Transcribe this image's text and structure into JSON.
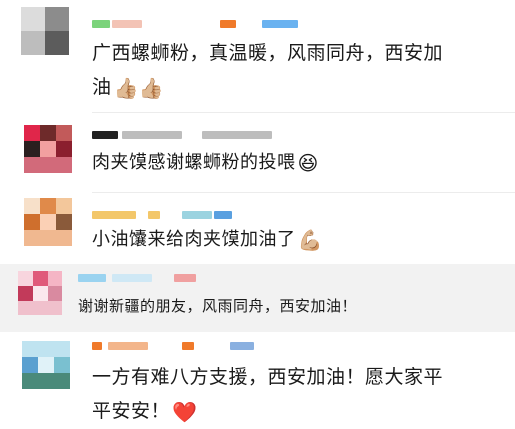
{
  "comments": [
    {
      "lines": [
        "广西螺蛳粉，真温暖，风雨同舟，西安加",
        "油"
      ],
      "emoji": "👍🏼👍🏼",
      "colors": {
        "avatar": [
          "#dcdcdc",
          "#8c8c8c",
          "#bdbdbd",
          "#5c5c5c",
          "#eeeeee",
          "#a5a5a5"
        ],
        "name": [
          "#7bd37b",
          "#f3c3b5",
          "#f07a2a",
          "#6ab2f0"
        ]
      }
    },
    {
      "lines": [
        "肉夹馍感谢螺蛳粉的投喂"
      ],
      "emoji": "😆",
      "colors": {
        "avatar": [
          "#e0264a",
          "#6e2a2a",
          "#c25a5a",
          "#2a1f1f",
          "#f2a0a0",
          "#8b1f2e"
        ],
        "name": [
          "#222222",
          "#bdbdbd",
          "#bdbdbd"
        ]
      }
    },
    {
      "lines": [
        "小油馕来给肉夹馍加油了"
      ],
      "emoji": "💪🏼",
      "colors": {
        "avatar": [
          "#f3c79b",
          "#e08a4a",
          "#f7e0c9",
          "#cf6f2d",
          "#fbd0b5",
          "#8a5a3a"
        ],
        "name": [
          "#f3c76a",
          "#9bd3e0",
          "#5aa0e0"
        ]
      }
    },
    {
      "lines": [
        "谢谢新疆的朋友，风雨同舟，西安加油！"
      ],
      "emoji": "",
      "colors": {
        "avatar": [
          "#f5b5c5",
          "#e05a7a",
          "#f8d5de",
          "#c23a5a",
          "#fbe8ed",
          "#d98aa0"
        ],
        "name": [
          "#9ad3f0",
          "#f0a0a0",
          "#cfe8f5"
        ]
      }
    },
    {
      "lines": [
        "一方有难八方支援，西安加油！愿大家平",
        "平安安！"
      ],
      "emoji": "❤️",
      "colors": {
        "avatar": [
          "#bfe3f0",
          "#5aa0d0",
          "#e0f2f8",
          "#4a8a7a",
          "#d8eef5",
          "#7ac0d0"
        ],
        "name": [
          "#f07a2a",
          "#f3b58a",
          "#f07a2a",
          "#8ab0e0"
        ]
      }
    }
  ]
}
